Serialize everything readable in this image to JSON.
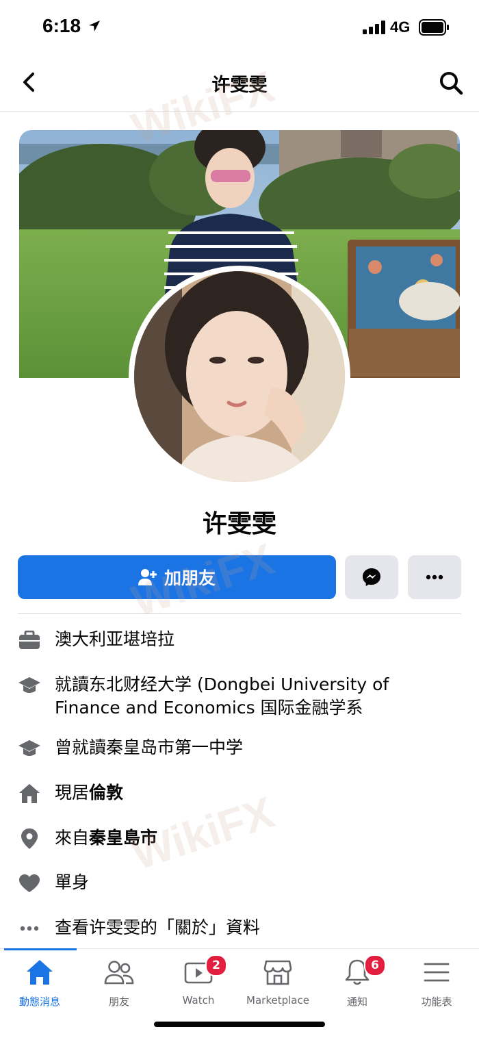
{
  "status_bar": {
    "time": "6:18",
    "network": "4G"
  },
  "nav": {
    "title": "许雯雯"
  },
  "profile": {
    "name": "许雯雯"
  },
  "actions": {
    "add_friend": "加朋友"
  },
  "info": [
    {
      "icon": "briefcase-icon",
      "text": "澳大利亚堪培拉"
    },
    {
      "icon": "graduation-cap-icon",
      "text": "就讀东北财经大学 (Dongbei University of Finance and Economics 国际金融学系"
    },
    {
      "icon": "graduation-cap-icon",
      "text": "曾就讀秦皇岛市第一中学"
    },
    {
      "icon": "home-icon",
      "prefix": "現居",
      "bold": "倫敦"
    },
    {
      "icon": "location-pin-icon",
      "prefix": "來自",
      "bold": "秦皇島市"
    },
    {
      "icon": "heart-icon",
      "text": "單身"
    },
    {
      "icon": "more-dots-icon",
      "text": "查看许雯雯的「關於」資料"
    }
  ],
  "tabs": [
    {
      "label": "動態消息",
      "icon": "home-tab-icon",
      "active": true
    },
    {
      "label": "朋友",
      "icon": "friends-icon"
    },
    {
      "label": "Watch",
      "icon": "watch-icon",
      "badge": "2"
    },
    {
      "label": "Marketplace",
      "icon": "marketplace-icon"
    },
    {
      "label": "通知",
      "icon": "bell-icon",
      "badge": "6"
    },
    {
      "label": "功能表",
      "icon": "menu-icon"
    }
  ],
  "watermark": "WikiFX",
  "colors": {
    "accent": "#1b74e4",
    "badge": "#e41e3f",
    "icon_gray": "#65676b"
  }
}
